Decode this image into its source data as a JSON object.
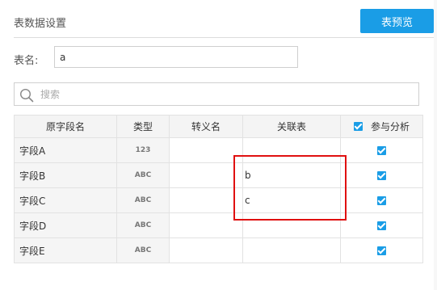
{
  "header": {
    "title": "表数据设置",
    "preview_button": "表预览"
  },
  "table_name": {
    "label": "表名:",
    "value": "a"
  },
  "search": {
    "placeholder": "搜索",
    "value": ""
  },
  "columns": {
    "source_name": "原字段名",
    "type": "类型",
    "alias": "转义名",
    "linked_table": "关联表",
    "participate": "参与分析"
  },
  "rows": [
    {
      "name": "字段A",
      "type": "123",
      "alias": "",
      "linked_table": "",
      "participate": true
    },
    {
      "name": "字段B",
      "type": "ABC",
      "alias": "",
      "linked_table": "b",
      "participate": true
    },
    {
      "name": "字段C",
      "type": "ABC",
      "alias": "",
      "linked_table": "c",
      "participate": true
    },
    {
      "name": "字段D",
      "type": "ABC",
      "alias": "",
      "linked_table": "",
      "participate": true
    },
    {
      "name": "字段E",
      "type": "ABC",
      "alias": "",
      "linked_table": "",
      "participate": true
    }
  ],
  "colors": {
    "accent": "#1a9de6",
    "highlight": "#e01010"
  }
}
